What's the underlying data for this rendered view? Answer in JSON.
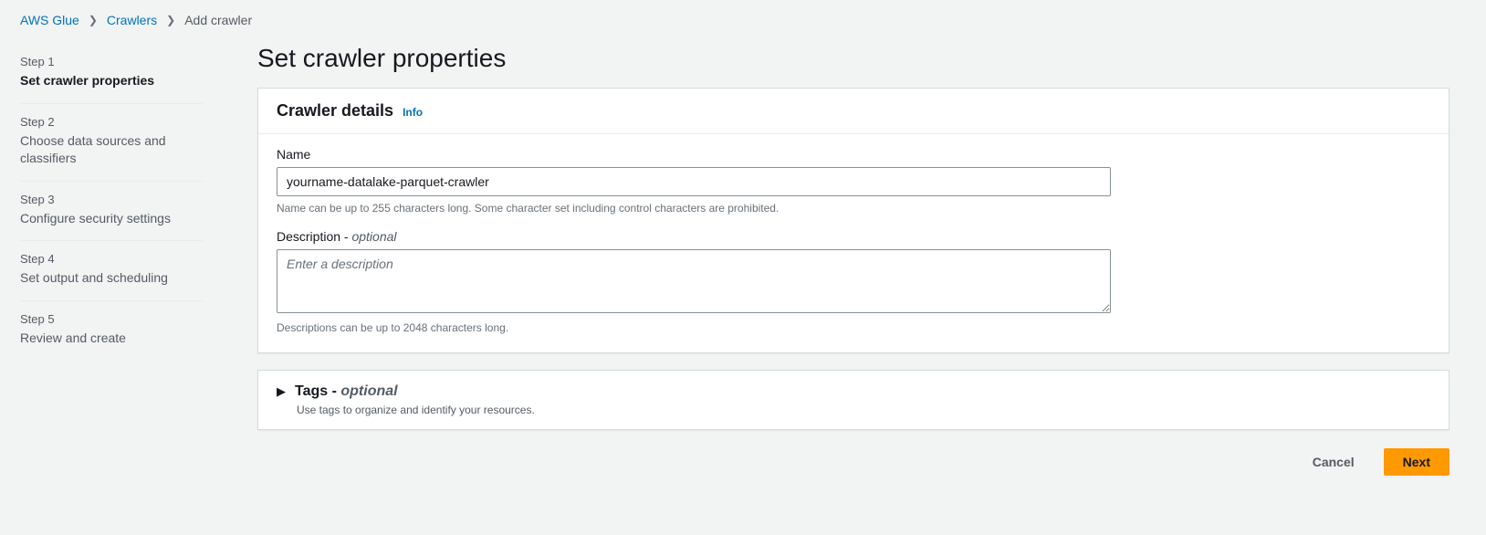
{
  "breadcrumbs": {
    "level1": "AWS Glue",
    "level2": "Crawlers",
    "level3": "Add crawler"
  },
  "steps": [
    {
      "num": "Step 1",
      "title": "Set crawler properties",
      "active": true
    },
    {
      "num": "Step 2",
      "title": "Choose data sources and classifiers",
      "active": false
    },
    {
      "num": "Step 3",
      "title": "Configure security settings",
      "active": false
    },
    {
      "num": "Step 4",
      "title": "Set output and scheduling",
      "active": false
    },
    {
      "num": "Step 5",
      "title": "Review and create",
      "active": false
    }
  ],
  "page_title": "Set crawler properties",
  "details": {
    "header": "Crawler details",
    "info": "Info",
    "name_label": "Name",
    "name_value": "yourname-datalake-parquet-crawler",
    "name_hint": "Name can be up to 255 characters long. Some character set including control characters are prohibited.",
    "desc_label_main": "Description - ",
    "desc_label_optional": "optional",
    "desc_placeholder": "Enter a description",
    "desc_value": "",
    "desc_hint": "Descriptions can be up to 2048 characters long."
  },
  "tags": {
    "title_main": "Tags - ",
    "title_optional": "optional",
    "desc": "Use tags to organize and identify your resources."
  },
  "actions": {
    "cancel": "Cancel",
    "next": "Next"
  }
}
